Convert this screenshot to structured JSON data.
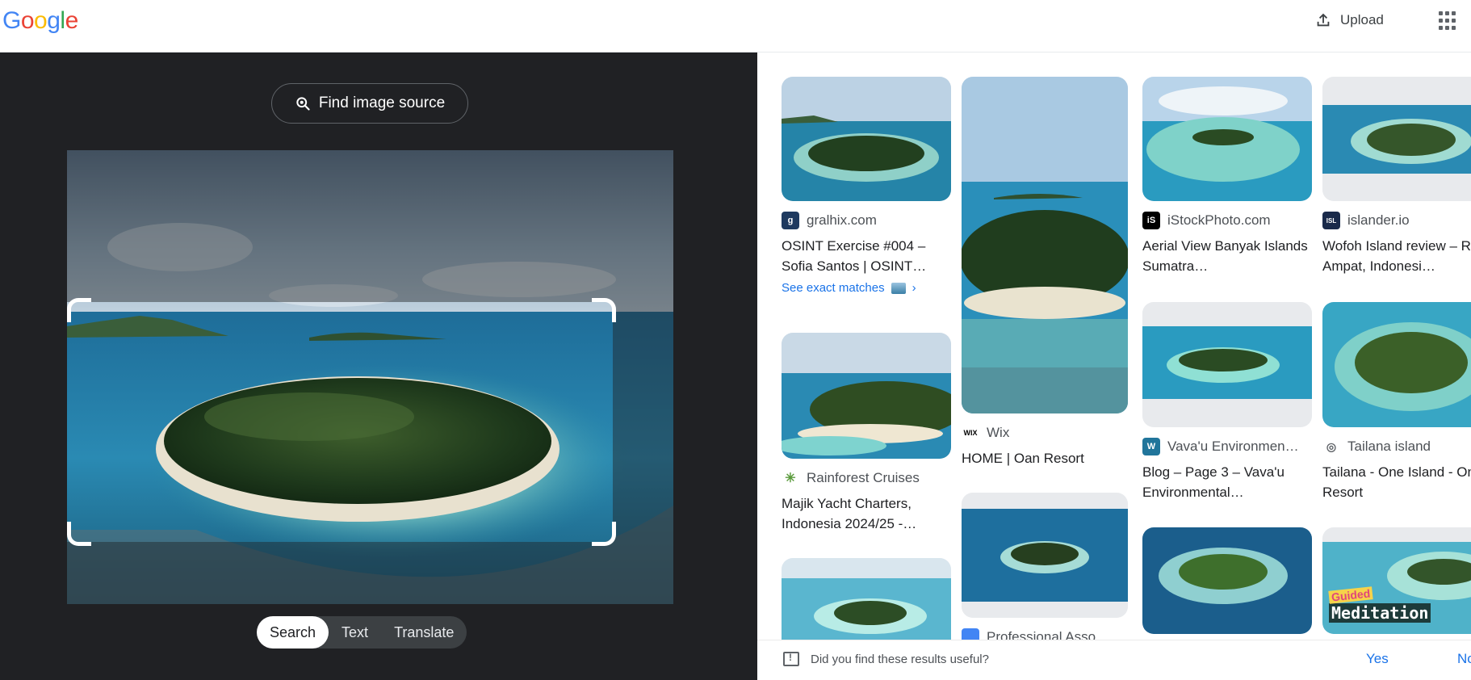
{
  "header": {
    "logo_letters": [
      "G",
      "o",
      "o",
      "g",
      "l",
      "e"
    ],
    "logo_colors": [
      "#4285F4",
      "#EA4335",
      "#FBBC05",
      "#4285F4",
      "#34A853",
      "#EA4335"
    ],
    "upload_label": "Upload",
    "apps_icon": "apps-grid-icon"
  },
  "lens_panel": {
    "find_source_label": "Find image source",
    "find_source_icon": "lens-search-icon",
    "tabs": [
      {
        "label": "Search",
        "active": true
      },
      {
        "label": "Text",
        "active": false
      },
      {
        "label": "Translate",
        "active": false
      }
    ]
  },
  "results": [
    {
      "source": "gralhix.com",
      "title": "OSINT Exercise #004 – Sofia Santos | OSINT…",
      "favicon_color": "#1f3a5f",
      "favicon_text": "g",
      "exact_matches": "See exact matches"
    },
    {
      "source": "Rainforest Cruises",
      "title": "Majik Yacht Charters, Indonesia 2024/25 -…",
      "favicon_color": "#ffffff",
      "favicon_text": "✳"
    },
    {
      "source": "Wix",
      "title": "HOME | Oan Resort",
      "favicon_color": "#ffffff",
      "favicon_text": "WIX"
    },
    {
      "source": "Professional Asso…",
      "title": "",
      "favicon_color": "#4285F4",
      "favicon_text": ""
    },
    {
      "source": "iStockPhoto.com",
      "title": "Aerial View Banyak Islands Sumatra…",
      "favicon_color": "#000000",
      "favicon_text": "iS"
    },
    {
      "source": "Vava'u Environmen…",
      "title": "Blog – Page 3 – Vava'u Environmental…",
      "favicon_color": "#21759b",
      "favicon_text": "W"
    },
    {
      "source": "islander.io",
      "title": "Wofoh Island review – Raja Ampat, Indonesi…",
      "favicon_color": "#1a2a4a",
      "favicon_text": "ISL"
    },
    {
      "source": "Tailana island",
      "title": "Tailana - One Island - One Resort",
      "favicon_color": "#ffffff",
      "favicon_text": "◎"
    }
  ],
  "overlay_text": {
    "line1": "Guided",
    "line2": "Meditation"
  },
  "feedback": {
    "question": "Did you find these results useful?",
    "yes": "Yes",
    "no": "No"
  }
}
